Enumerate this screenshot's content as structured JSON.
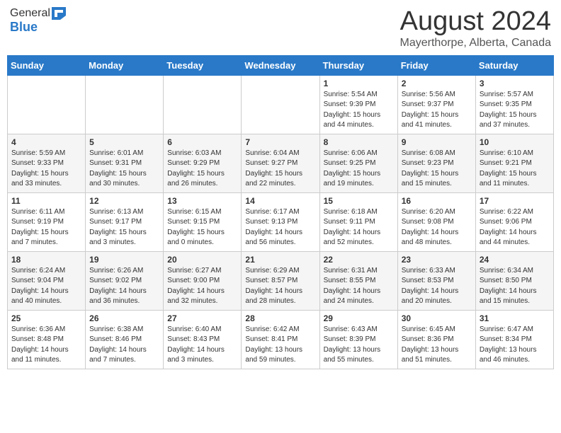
{
  "logo": {
    "general": "General",
    "blue": "Blue"
  },
  "title": {
    "month_year": "August 2024",
    "location": "Mayerthorpe, Alberta, Canada"
  },
  "headers": [
    "Sunday",
    "Monday",
    "Tuesday",
    "Wednesday",
    "Thursday",
    "Friday",
    "Saturday"
  ],
  "weeks": [
    [
      {
        "day": "",
        "info": ""
      },
      {
        "day": "",
        "info": ""
      },
      {
        "day": "",
        "info": ""
      },
      {
        "day": "",
        "info": ""
      },
      {
        "day": "1",
        "info": "Sunrise: 5:54 AM\nSunset: 9:39 PM\nDaylight: 15 hours\nand 44 minutes."
      },
      {
        "day": "2",
        "info": "Sunrise: 5:56 AM\nSunset: 9:37 PM\nDaylight: 15 hours\nand 41 minutes."
      },
      {
        "day": "3",
        "info": "Sunrise: 5:57 AM\nSunset: 9:35 PM\nDaylight: 15 hours\nand 37 minutes."
      }
    ],
    [
      {
        "day": "4",
        "info": "Sunrise: 5:59 AM\nSunset: 9:33 PM\nDaylight: 15 hours\nand 33 minutes."
      },
      {
        "day": "5",
        "info": "Sunrise: 6:01 AM\nSunset: 9:31 PM\nDaylight: 15 hours\nand 30 minutes."
      },
      {
        "day": "6",
        "info": "Sunrise: 6:03 AM\nSunset: 9:29 PM\nDaylight: 15 hours\nand 26 minutes."
      },
      {
        "day": "7",
        "info": "Sunrise: 6:04 AM\nSunset: 9:27 PM\nDaylight: 15 hours\nand 22 minutes."
      },
      {
        "day": "8",
        "info": "Sunrise: 6:06 AM\nSunset: 9:25 PM\nDaylight: 15 hours\nand 19 minutes."
      },
      {
        "day": "9",
        "info": "Sunrise: 6:08 AM\nSunset: 9:23 PM\nDaylight: 15 hours\nand 15 minutes."
      },
      {
        "day": "10",
        "info": "Sunrise: 6:10 AM\nSunset: 9:21 PM\nDaylight: 15 hours\nand 11 minutes."
      }
    ],
    [
      {
        "day": "11",
        "info": "Sunrise: 6:11 AM\nSunset: 9:19 PM\nDaylight: 15 hours\nand 7 minutes."
      },
      {
        "day": "12",
        "info": "Sunrise: 6:13 AM\nSunset: 9:17 PM\nDaylight: 15 hours\nand 3 minutes."
      },
      {
        "day": "13",
        "info": "Sunrise: 6:15 AM\nSunset: 9:15 PM\nDaylight: 15 hours\nand 0 minutes."
      },
      {
        "day": "14",
        "info": "Sunrise: 6:17 AM\nSunset: 9:13 PM\nDaylight: 14 hours\nand 56 minutes."
      },
      {
        "day": "15",
        "info": "Sunrise: 6:18 AM\nSunset: 9:11 PM\nDaylight: 14 hours\nand 52 minutes."
      },
      {
        "day": "16",
        "info": "Sunrise: 6:20 AM\nSunset: 9:08 PM\nDaylight: 14 hours\nand 48 minutes."
      },
      {
        "day": "17",
        "info": "Sunrise: 6:22 AM\nSunset: 9:06 PM\nDaylight: 14 hours\nand 44 minutes."
      }
    ],
    [
      {
        "day": "18",
        "info": "Sunrise: 6:24 AM\nSunset: 9:04 PM\nDaylight: 14 hours\nand 40 minutes."
      },
      {
        "day": "19",
        "info": "Sunrise: 6:26 AM\nSunset: 9:02 PM\nDaylight: 14 hours\nand 36 minutes."
      },
      {
        "day": "20",
        "info": "Sunrise: 6:27 AM\nSunset: 9:00 PM\nDaylight: 14 hours\nand 32 minutes."
      },
      {
        "day": "21",
        "info": "Sunrise: 6:29 AM\nSunset: 8:57 PM\nDaylight: 14 hours\nand 28 minutes."
      },
      {
        "day": "22",
        "info": "Sunrise: 6:31 AM\nSunset: 8:55 PM\nDaylight: 14 hours\nand 24 minutes."
      },
      {
        "day": "23",
        "info": "Sunrise: 6:33 AM\nSunset: 8:53 PM\nDaylight: 14 hours\nand 20 minutes."
      },
      {
        "day": "24",
        "info": "Sunrise: 6:34 AM\nSunset: 8:50 PM\nDaylight: 14 hours\nand 15 minutes."
      }
    ],
    [
      {
        "day": "25",
        "info": "Sunrise: 6:36 AM\nSunset: 8:48 PM\nDaylight: 14 hours\nand 11 minutes."
      },
      {
        "day": "26",
        "info": "Sunrise: 6:38 AM\nSunset: 8:46 PM\nDaylight: 14 hours\nand 7 minutes."
      },
      {
        "day": "27",
        "info": "Sunrise: 6:40 AM\nSunset: 8:43 PM\nDaylight: 14 hours\nand 3 minutes."
      },
      {
        "day": "28",
        "info": "Sunrise: 6:42 AM\nSunset: 8:41 PM\nDaylight: 13 hours\nand 59 minutes."
      },
      {
        "day": "29",
        "info": "Sunrise: 6:43 AM\nSunset: 8:39 PM\nDaylight: 13 hours\nand 55 minutes."
      },
      {
        "day": "30",
        "info": "Sunrise: 6:45 AM\nSunset: 8:36 PM\nDaylight: 13 hours\nand 51 minutes."
      },
      {
        "day": "31",
        "info": "Sunrise: 6:47 AM\nSunset: 8:34 PM\nDaylight: 13 hours\nand 46 minutes."
      }
    ]
  ]
}
